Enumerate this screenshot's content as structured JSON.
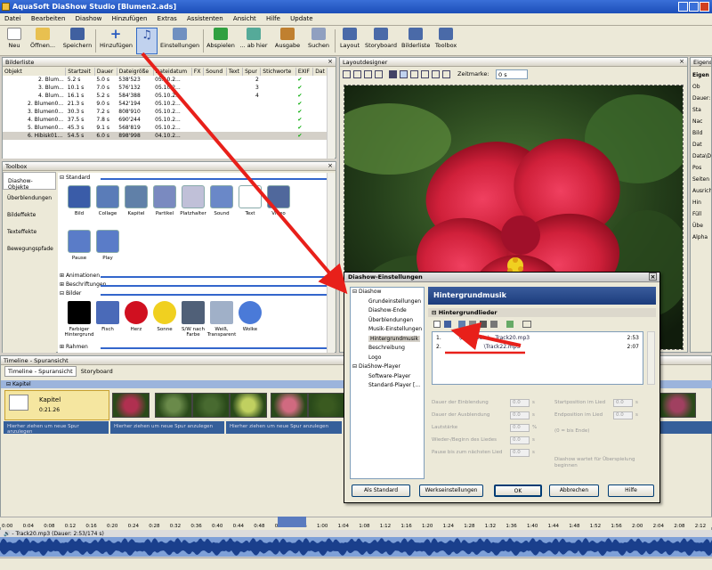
{
  "window": {
    "title": "AquaSoft DiaShow Studio [Blumen2.ads]"
  },
  "menu": [
    "Datei",
    "Bearbeiten",
    "Diashow",
    "Hinzufügen",
    "Extras",
    "Assistenten",
    "Ansicht",
    "Hilfe",
    "Update"
  ],
  "toolbar": [
    {
      "label": "Neu",
      "icon": "new-file-icon"
    },
    {
      "label": "Öffnen...",
      "icon": "open-folder-icon"
    },
    {
      "label": "Speichern",
      "icon": "save-icon"
    },
    {
      "label": "Hinzufügen",
      "icon": "add-icon"
    },
    {
      "label": "",
      "icon": "music-note-icon"
    },
    {
      "label": "Einstellungen",
      "icon": "settings-icon"
    },
    {
      "label": "Abspielen",
      "icon": "play-icon"
    },
    {
      "label": "... ab hier",
      "icon": "play-from-here-icon"
    },
    {
      "label": "Ausgabe",
      "icon": "output-icon"
    },
    {
      "label": "Suchen",
      "icon": "search-icon"
    },
    {
      "label": "Layout",
      "icon": "layout-icon"
    },
    {
      "label": "Storyboard",
      "icon": "storyboard-icon"
    },
    {
      "label": "Bilderliste",
      "icon": "image-list-icon"
    },
    {
      "label": "Toolbox",
      "icon": "toolbox-icon"
    }
  ],
  "bilderliste": {
    "title": "Bilderliste",
    "columns": [
      "Objekt",
      "Startzeit",
      "Dauer",
      "Dateigröße",
      "Dateidatum",
      "FX",
      "Sound",
      "Text",
      "Spur",
      "Stichworte",
      "EXIF",
      "Dat"
    ],
    "rows": [
      {
        "name": "2. Blum...",
        "start": "5.2 s",
        "dur": "5.0 s",
        "size": "538'523",
        "date": "05.10.2...",
        "spur": "2"
      },
      {
        "name": "3. Blum...",
        "start": "10.1 s",
        "dur": "7.0 s",
        "size": "576'132",
        "date": "05.10.2...",
        "spur": "3"
      },
      {
        "name": "4. Blum...",
        "start": "16.1 s",
        "dur": "5.2 s",
        "size": "584'388",
        "date": "05.10.2...",
        "spur": "4"
      },
      {
        "name": "2. Blumen0...",
        "start": "21.3 s",
        "dur": "9.0 s",
        "size": "542'194",
        "date": "05.10.2...",
        "spur": ""
      },
      {
        "name": "3. Blumen0...",
        "start": "30.3 s",
        "dur": "7.2 s",
        "size": "808'910",
        "date": "05.10.2...",
        "spur": ""
      },
      {
        "name": "4. Blumen0...",
        "start": "37.5 s",
        "dur": "7.8 s",
        "size": "690'244",
        "date": "05.10.2...",
        "spur": ""
      },
      {
        "name": "5. Blumen0...",
        "start": "45.3 s",
        "dur": "9.1 s",
        "size": "568'819",
        "date": "05.10.2...",
        "spur": ""
      },
      {
        "name": "6. Hibisk01...",
        "start": "54.5 s",
        "dur": "6.0 s",
        "size": "898'998",
        "date": "04.10.2...",
        "spur": ""
      }
    ]
  },
  "toolbox": {
    "title": "Toolbox",
    "tabs": [
      "Diashow-Objekte",
      "Überblendungen",
      "Bildeffekte",
      "Texteffekte",
      "Bewegungspfade"
    ],
    "sections": {
      "standard": "Standard",
      "animationen": "Animationen",
      "beschriftungen": "Beschriftungen",
      "bilder": "Bilder",
      "rahmen": "Rahmen"
    },
    "standard_items": [
      "Bild",
      "Collage",
      "Kapitel",
      "Partikel",
      "Platzhalter",
      "Sound",
      "Text",
      "Video",
      "Pause",
      "Play"
    ],
    "bilder_items": [
      "Farbiger Hintergrund",
      "Fisch",
      "Herz",
      "Sonne",
      "S/W nach Farbe",
      "Weiß, Transparent",
      "Wolke"
    ]
  },
  "layoutdesigner": {
    "title": "Layoutdesigner",
    "zeitmarke_label": "Zeitmarke:",
    "zeitmarke_value": "0 s"
  },
  "eigenschaften": {
    "title": "Eigensch",
    "items": [
      "Eigen",
      "Ob",
      "Dauer:",
      "Sta",
      "Nac",
      "Bild",
      "Dat",
      "Data\\D",
      "Pos",
      "Seiten",
      "Ausrich",
      "Hin",
      "Füll",
      "Übe",
      "Alpha"
    ]
  },
  "dialog": {
    "title": "Diashow-Einstellungen",
    "tree": [
      "Diashow",
      "Grundeinstellungen",
      "Diashow-Ende",
      "Überblendungen",
      "Musik-Einstellungen",
      "Hintergrundmusik",
      "Beschreibung",
      "Logo",
      "DiaShow-Player",
      "Software-Player",
      "Standard-Player [..."
    ],
    "header": "Hintergrundmusik",
    "subheader": "Hintergrundlieder",
    "tracks": [
      {
        "num": "1.",
        "path": "\\Data\\Data\\ - Track20.mp3",
        "dur": "2:53"
      },
      {
        "num": "2.",
        "path": "\\Track22.mp3",
        "dur": "2:07"
      }
    ],
    "fields": [
      {
        "label": "Dauer der Einblendung",
        "value": "0.0",
        "unit": "s"
      },
      {
        "label": "Dauer der Ausblendung",
        "value": "0.0",
        "unit": "s"
      },
      {
        "label": "Lautstärke",
        "value": "0.0",
        "unit": "%"
      },
      {
        "label": "Wieder-/Beginn des Liedes",
        "value": "0.0",
        "unit": "s"
      },
      {
        "label": "Pause bis zum nächsten Lied",
        "value": "0.0",
        "unit": "s"
      }
    ],
    "fields_right": [
      {
        "label": "Startposition im Lied",
        "value": "0.0",
        "unit": "s"
      },
      {
        "label": "Endposition im Lied",
        "value": "0.0",
        "unit": "s"
      }
    ],
    "end_note": "(0 = bis Ende)",
    "sync_note": "Diashow wartet für Überspielung beginnen",
    "buttons": [
      "Als Standard",
      "Werkseinstellungen",
      "OK",
      "Abbrechen",
      "Hilfe"
    ]
  },
  "timeline": {
    "title": "Timeline - Spuransicht",
    "tabs": [
      "Timeline - Spuransicht",
      "Storyboard"
    ],
    "kapitel_label": "Kapitel",
    "chapter": {
      "title": "Kapitel",
      "time": "0:21.26"
    },
    "hint": "Hierher ziehen um neue Spur anzulegen",
    "ruler": [
      "0:00",
      "0:04",
      "0:08",
      "0:12",
      "0:16",
      "0:20",
      "0:24",
      "0:28",
      "0:32",
      "0:36",
      "0:40",
      "0:44",
      "0:48",
      "0:52",
      "0:56",
      "1:00",
      "1:04",
      "1:08",
      "1:12",
      "1:16",
      "1:20",
      "1:24",
      "1:28",
      "1:32",
      "1:36",
      "1:40",
      "1:44",
      "1:48",
      "1:52",
      "1:56",
      "2:00",
      "2:04",
      "2:08",
      "2:12"
    ],
    "audio_track": "- Track20.mp3 (Dauer: 2:53/174 s)"
  },
  "colors": {
    "accent": "#316ac5",
    "arrow": "#e8201a",
    "title": "#1c4eb8"
  }
}
